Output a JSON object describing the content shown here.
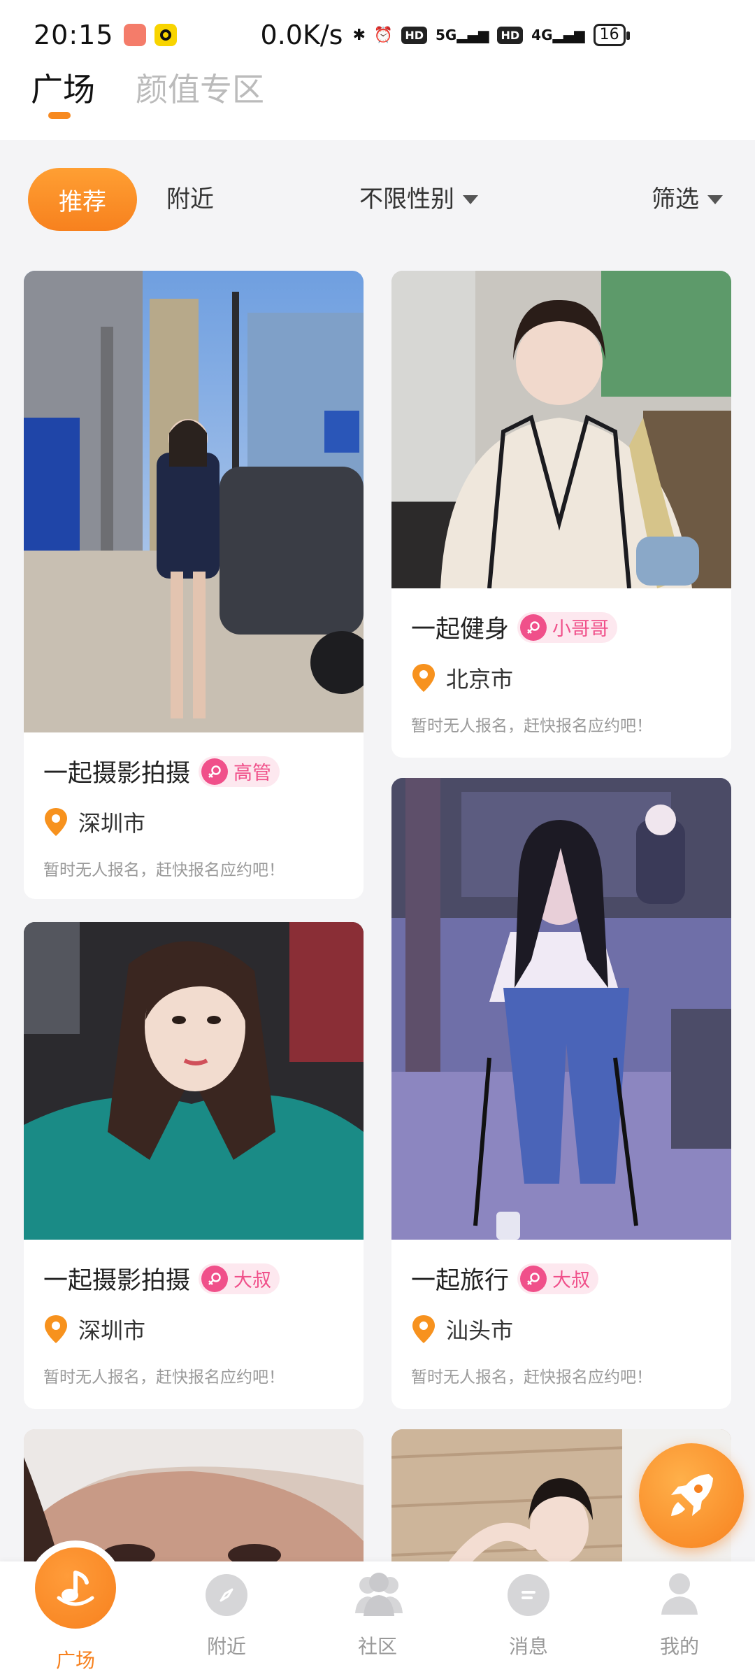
{
  "status_bar": {
    "time": "20:15",
    "speed": "0.0K/s",
    "net1": "5G",
    "net2": "4G",
    "battery": "16"
  },
  "header": {
    "tabs": [
      {
        "label": "广场",
        "active": true
      },
      {
        "label": "颜值专区",
        "active": false
      }
    ]
  },
  "filters": {
    "recommend": "推荐",
    "nearby": "附近",
    "gender": "不限性别",
    "screen": "筛选"
  },
  "cards": [
    {
      "activity": "一起摄影拍摄",
      "tag": "高管",
      "city": "深圳市",
      "note": "暂时无人报名，赶快报名应约吧！"
    },
    {
      "activity": "一起健身",
      "tag": "小哥哥",
      "city": "北京市",
      "note": "暂时无人报名，赶快报名应约吧！"
    },
    {
      "activity": "一起摄影拍摄",
      "tag": "大叔",
      "city": "深圳市",
      "note": "暂时无人报名，赶快报名应约吧！"
    },
    {
      "activity": "一起旅行",
      "tag": "大叔",
      "city": "汕头市",
      "note": "暂时无人报名，赶快报名应约吧！"
    }
  ],
  "bottom_nav": [
    {
      "label": "广场",
      "icon": "music-note-icon",
      "active": true
    },
    {
      "label": "附近",
      "icon": "compass-icon"
    },
    {
      "label": "社区",
      "icon": "group-icon"
    },
    {
      "label": "消息",
      "icon": "message-icon"
    },
    {
      "label": "我的",
      "icon": "person-icon"
    }
  ],
  "colors": {
    "accent": "#f7811e",
    "tag_pink": "#f0508a",
    "tag_bg": "#fde8ef",
    "background": "#f4f4f6"
  }
}
